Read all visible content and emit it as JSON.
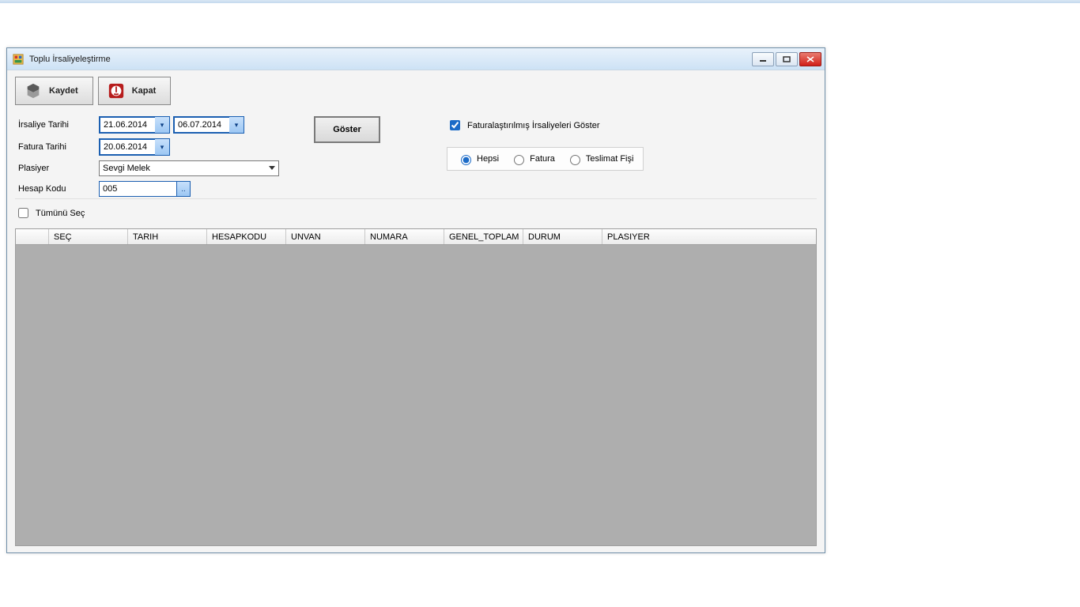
{
  "window": {
    "title": "Toplu İrsaliyeleştirme"
  },
  "toolbar": {
    "save_label": "Kaydet",
    "close_label": "Kapat"
  },
  "filters": {
    "irsaliye_tarihi_label": "İrsaliye Tarihi",
    "irsaliye_tarihi_from": "21.06.2014",
    "irsaliye_tarihi_to": "06.07.2014",
    "fatura_tarihi_label": "Fatura Tarihi",
    "fatura_tarihi": "20.06.2014",
    "plasiyer_label": "Plasiyer",
    "plasiyer_value": "Sevgi Melek",
    "hesap_kodu_label": "Hesap Kodu",
    "hesap_kodu_value": "005",
    "goster_label": "Göster",
    "fatura_irsaliye_goster_label": "Faturalaştırılmış İrsaliyeleri Göster",
    "filter_hepsi": "Hepsi",
    "filter_fatura": "Fatura",
    "filter_teslimat": "Teslimat Fişi",
    "tumunu_sec_label": "Tümünü Seç"
  },
  "grid": {
    "columns": {
      "sec": "SEÇ",
      "tarih": "TARIH",
      "hesapkodu": "HESAPKODU",
      "unvan": "UNVAN",
      "numara": "NUMARA",
      "genel_toplam": "GENEL_TOPLAM",
      "durum": "DURUM",
      "plasiyer": "PLASIYER"
    }
  }
}
